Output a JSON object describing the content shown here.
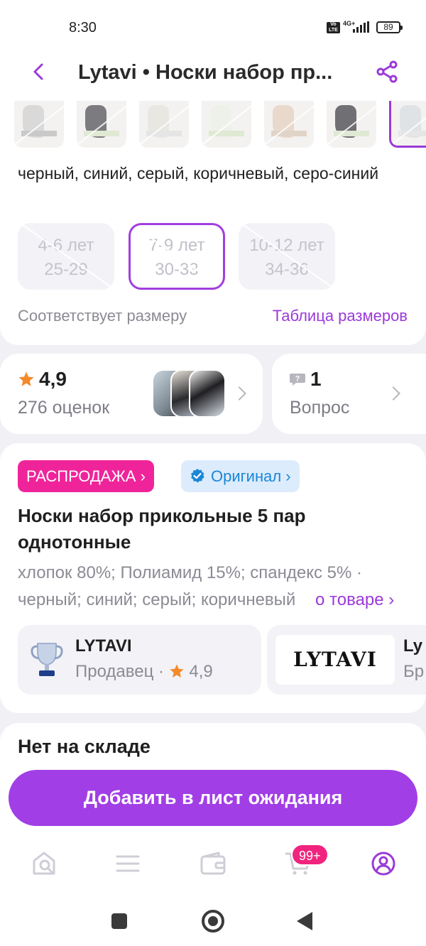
{
  "status_bar": {
    "time": "8:30",
    "volte": "Vo LTE",
    "network": "4G+",
    "battery": "89"
  },
  "header": {
    "title": "Lytavi • Носки набор пр..."
  },
  "variants": {
    "colors_text": "черный, синий, серый, коричневый, серо-синий",
    "sizes": [
      {
        "age": "4-6 лет",
        "size": "25-29",
        "selected": false,
        "available": false
      },
      {
        "age": "7-9 лет",
        "size": "30-33",
        "selected": true,
        "available": false
      },
      {
        "age": "10-12 лет",
        "size": "34-36",
        "selected": false,
        "available": false
      }
    ],
    "fit_text": "Соответствует размеру",
    "size_table_link": "Таблица размеров"
  },
  "rating": {
    "score": "4,9",
    "count": "276 оценок"
  },
  "questions": {
    "count": "1",
    "label": "Вопрос"
  },
  "product": {
    "badge_sale": "РАСПРОДАЖА ›",
    "badge_original": "Оригинал ›",
    "name": "Носки набор прикольные 5 пар однотонные",
    "description": "хлопок 80%; Полиамид 15%; спандекс 5% · черный; синий; серый; коричневый",
    "about_link": "о товаре ›"
  },
  "seller": {
    "name": "LYTAVI",
    "role": "Продавец ·",
    "rating": "4,9"
  },
  "brand": {
    "logo_text": "LYTAVI",
    "name": "Ly",
    "role": "Бр"
  },
  "stock": {
    "title": "Нет на складе",
    "button": "Добавить в лист ожидания"
  },
  "tabbar": {
    "cart_badge": "99+"
  },
  "colors": {
    "accent": "#9b3ad8",
    "sale": "#f0249a",
    "original_bg": "#dcecfc",
    "star": "#f48a2a",
    "button": "#a13ee6"
  }
}
